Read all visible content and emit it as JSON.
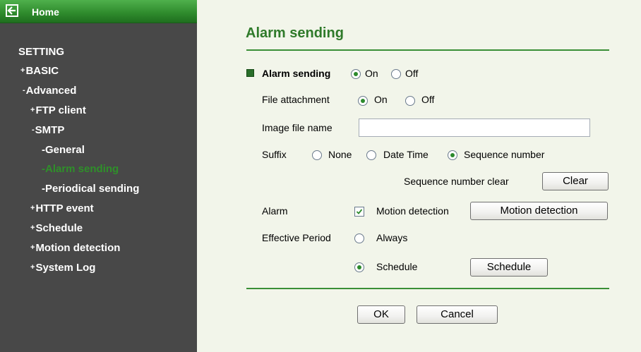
{
  "sidebar": {
    "home_label": "Home",
    "items": [
      {
        "prefix": "",
        "label": "SETTING"
      },
      {
        "prefix": "+",
        "label": "BASIC"
      },
      {
        "prefix": "-",
        "label": "Advanced"
      },
      {
        "prefix": "+",
        "label": "FTP client"
      },
      {
        "prefix": "-",
        "label": "SMTP"
      },
      {
        "prefix": "-",
        "label": "General"
      },
      {
        "prefix": "-",
        "label": "Alarm sending"
      },
      {
        "prefix": "-",
        "label": "Periodical sending"
      },
      {
        "prefix": "+",
        "label": "HTTP event"
      },
      {
        "prefix": "+",
        "label": "Schedule"
      },
      {
        "prefix": "+",
        "label": "Motion detection"
      },
      {
        "prefix": "+",
        "label": "System Log"
      }
    ]
  },
  "main": {
    "title": "Alarm sending",
    "alarm_sending": {
      "label": "Alarm sending",
      "on": "On",
      "off": "Off",
      "selected": "On"
    },
    "file_attachment": {
      "label": "File attachment",
      "on": "On",
      "off": "Off",
      "selected": "On"
    },
    "image_file_name": {
      "label": "Image file name",
      "value": ""
    },
    "suffix": {
      "label": "Suffix",
      "none": "None",
      "date_time": "Date Time",
      "sequence": "Sequence number",
      "selected": "Sequence number"
    },
    "sequence_clear": {
      "label": "Sequence number clear",
      "button": "Clear"
    },
    "alarm": {
      "label": "Alarm",
      "checkbox_label": "Motion detection",
      "checked": true,
      "button": "Motion detection"
    },
    "effective_period": {
      "label": "Effective Period",
      "always": "Always",
      "schedule": "Schedule",
      "selected": "Schedule",
      "button": "Schedule"
    },
    "ok_button": "OK",
    "cancel_button": "Cancel"
  },
  "colors": {
    "sidebar_bg": "#484848",
    "home_bar": "#2e8a2c",
    "accent": "#2f7a2a",
    "page_bg": "#f2f5ea",
    "active_item": "#2f8f2a"
  }
}
